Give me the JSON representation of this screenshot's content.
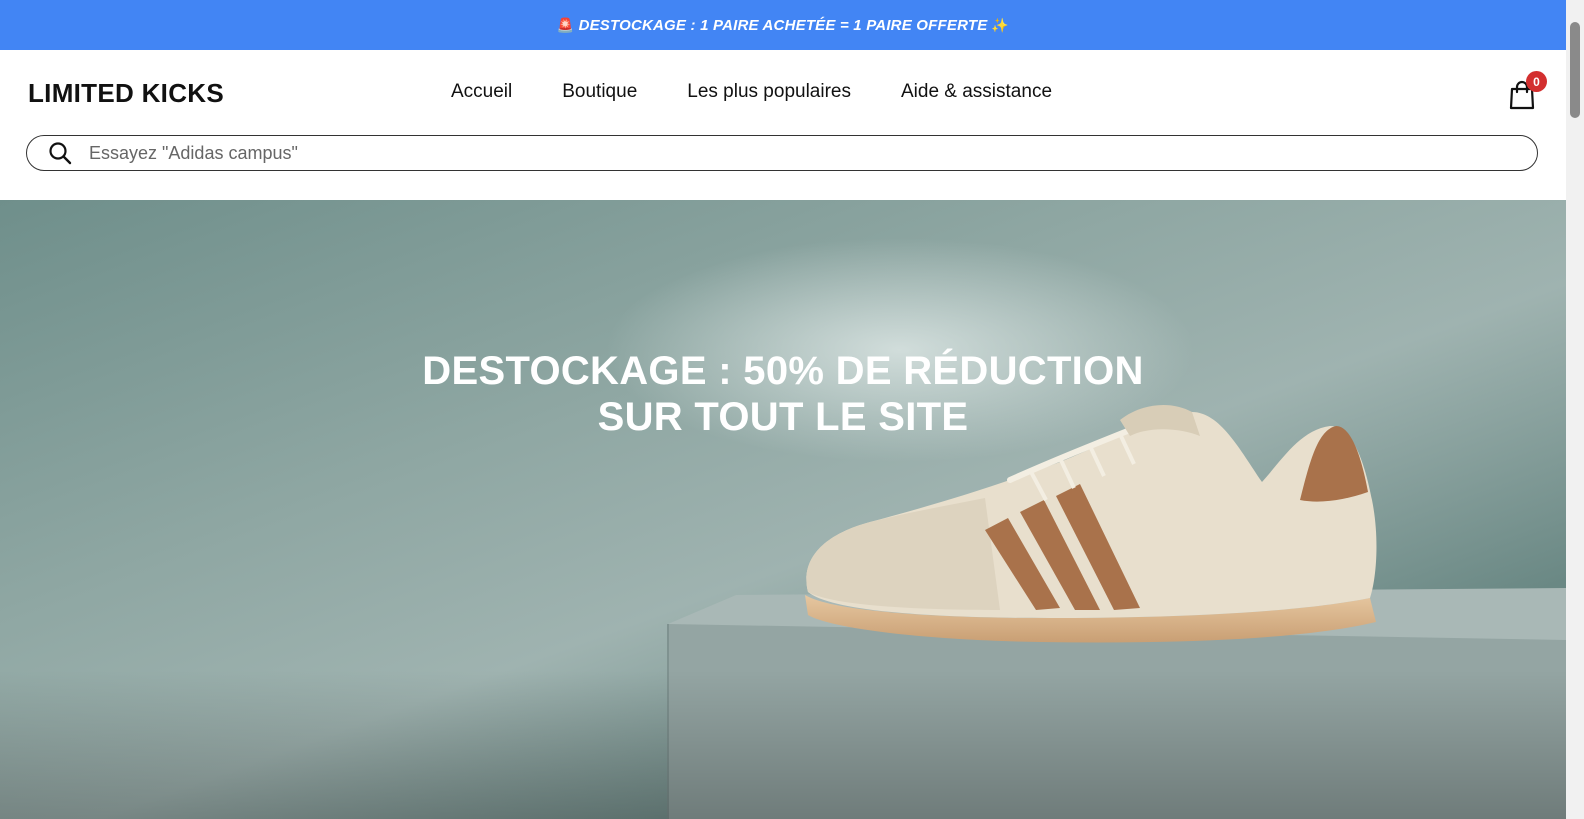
{
  "announcement": {
    "emoji_left": "🚨",
    "text": "DESTOCKAGE : 1 PAIRE ACHETÉE = 1 PAIRE OFFERTE",
    "emoji_right": "✨",
    "background_color": "#4285f4"
  },
  "header": {
    "logo": "LIMITED KICKS",
    "nav": [
      {
        "label": "Accueil"
      },
      {
        "label": "Boutique"
      },
      {
        "label": "Les plus populaires"
      },
      {
        "label": "Aide & assistance"
      }
    ],
    "cart": {
      "icon": "shopping-bag-icon",
      "count": "0",
      "badge_color": "#d32f2f"
    },
    "search": {
      "icon": "search-icon",
      "placeholder": "Essayez \"Adidas campus\""
    }
  },
  "hero": {
    "title_line1": "DESTOCKAGE : 50% DE RÉDUCTION",
    "title_line2": "SUR TOUT LE SITE",
    "image": "sneaker-on-pedestal"
  }
}
